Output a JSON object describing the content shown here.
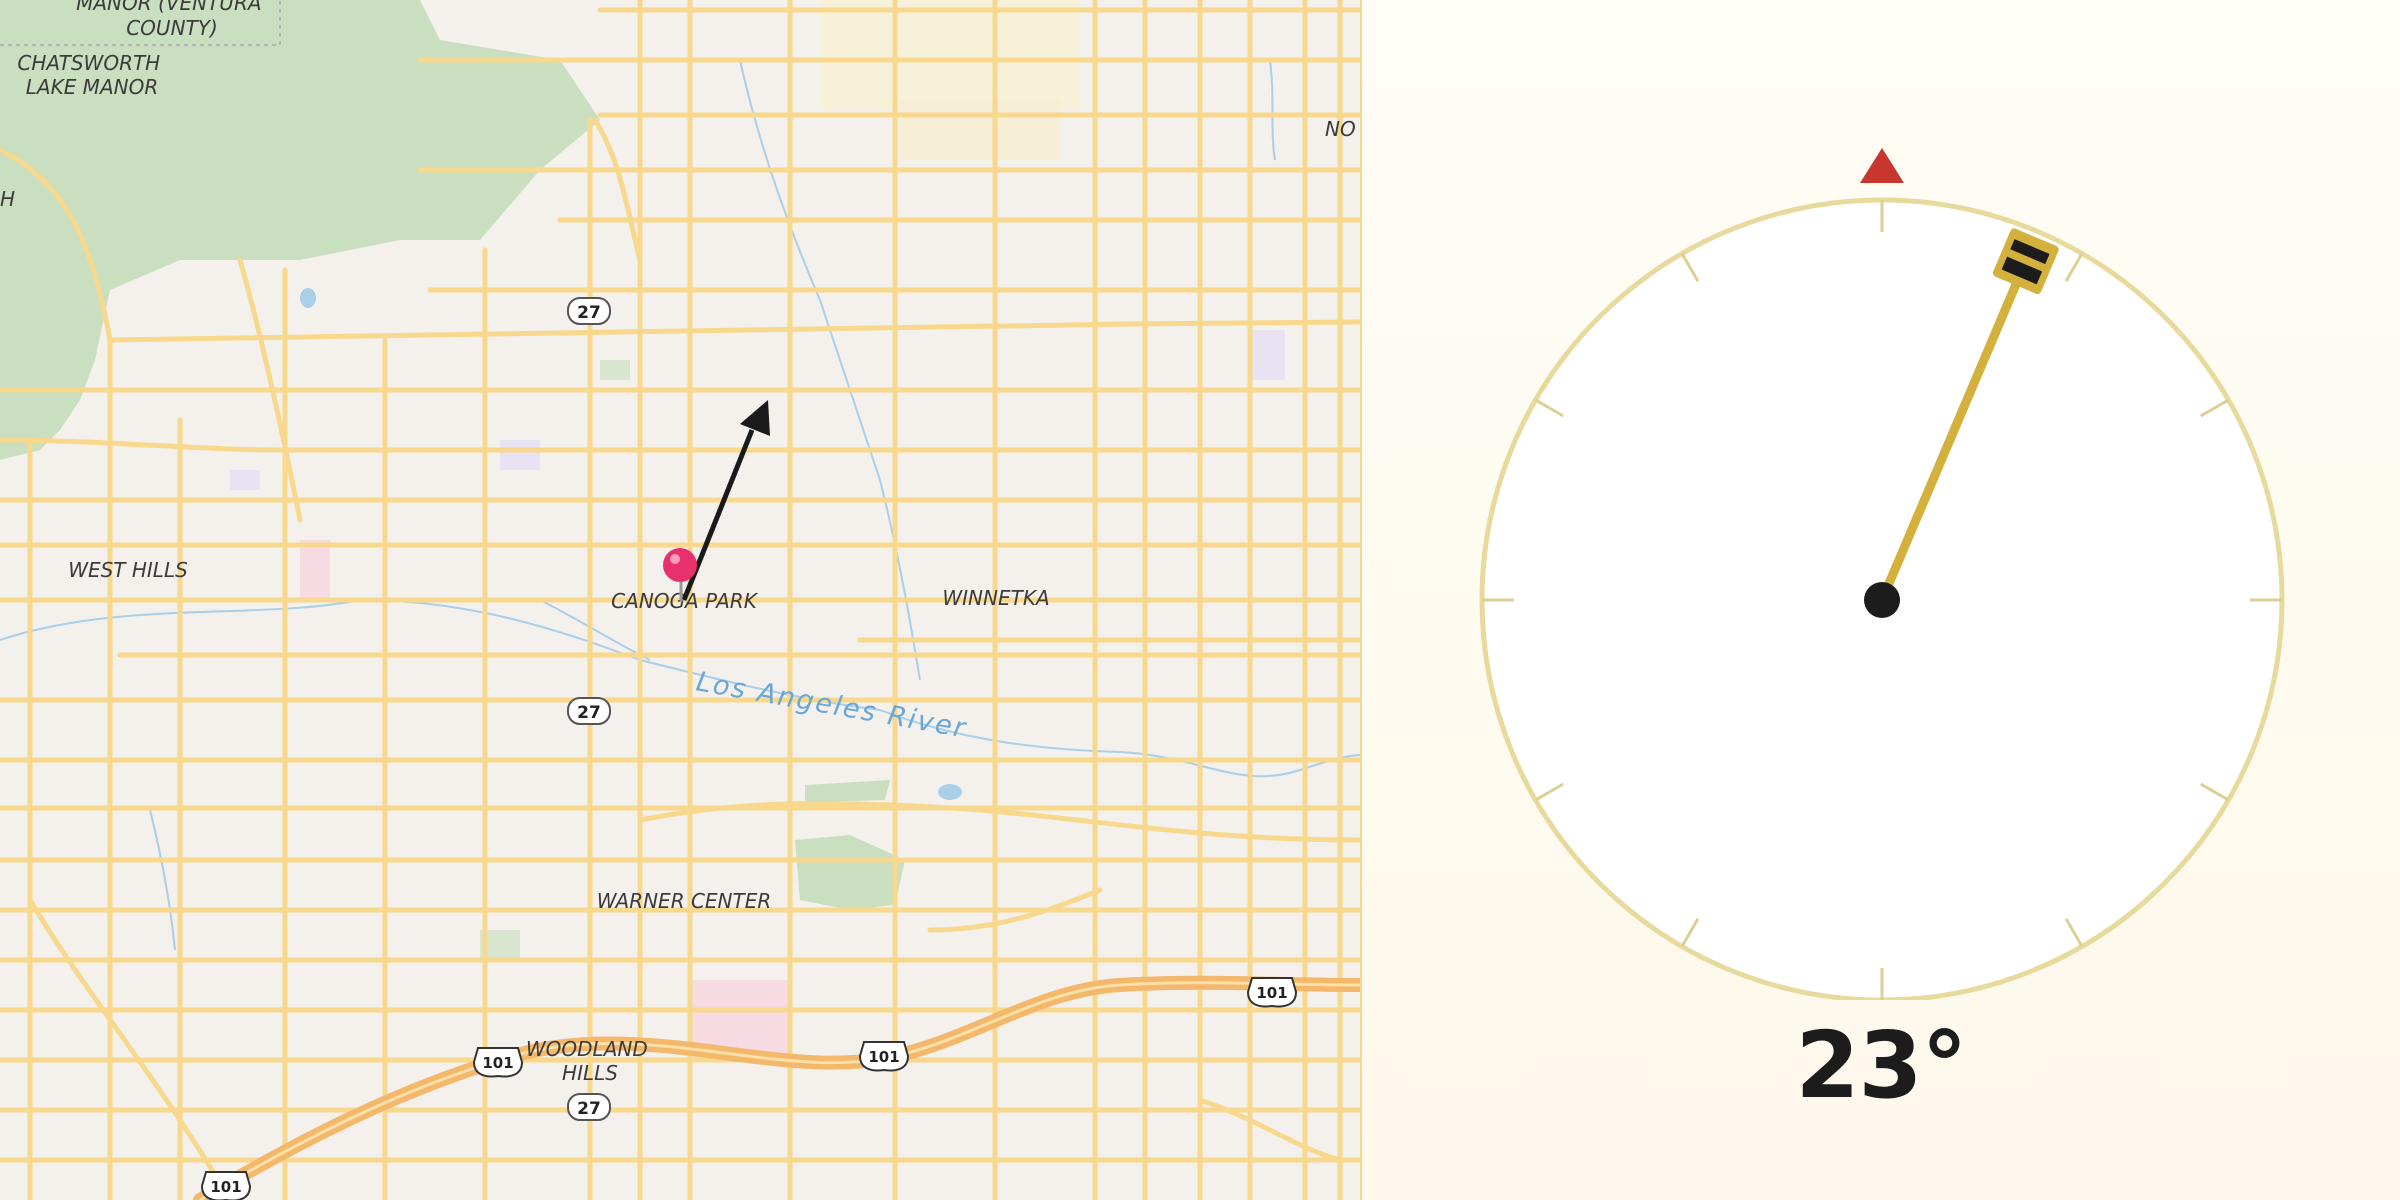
{
  "map": {
    "places": [
      {
        "id": "manor",
        "lines": [
          "MANOR (VENTURA",
          "COUNTY)"
        ]
      },
      {
        "id": "chatsworth-lake-manor",
        "lines": [
          "CHATSWORTH",
          "LAKE MANOR"
        ]
      },
      {
        "id": "west-hills",
        "lines": [
          "WEST HILLS"
        ]
      },
      {
        "id": "canoga-park",
        "lines": [
          "CANOGA PARK"
        ]
      },
      {
        "id": "winnetka",
        "lines": [
          "WINNETKA"
        ]
      },
      {
        "id": "warner-center",
        "lines": [
          "WARNER CENTER"
        ]
      },
      {
        "id": "woodland-hills",
        "lines": [
          "WOODLAND",
          "HILLS"
        ]
      },
      {
        "id": "edge-no",
        "lines": [
          "NO"
        ]
      },
      {
        "id": "edge-h",
        "lines": [
          "H"
        ]
      }
    ],
    "river_label": "Los Angeles River",
    "shields": [
      {
        "id": "sr27-north",
        "label": "27",
        "type": "state"
      },
      {
        "id": "sr27-mid",
        "label": "27",
        "type": "state"
      },
      {
        "id": "sr27-south",
        "label": "27",
        "type": "state"
      },
      {
        "id": "us101-west",
        "label": "101",
        "type": "us"
      },
      {
        "id": "us101-mid",
        "label": "101",
        "type": "us"
      },
      {
        "id": "us101-east",
        "label": "101",
        "type": "us"
      },
      {
        "id": "us101-sw",
        "label": "101",
        "type": "us"
      }
    ],
    "marker": {
      "icon": "map-pin-icon",
      "color": "#e8306e"
    },
    "heading_arrow": {
      "icon": "direction-arrow-icon",
      "color": "#1a1a1a"
    }
  },
  "compass": {
    "heading_deg": 23,
    "heading_text": "23°",
    "north_marker_color": "#c8372d",
    "needle_color": "#d4b03c",
    "ring_color": "#e8da9c"
  },
  "colors": {
    "road": "#f7d88d",
    "freeway": "#f3b86b",
    "park": "#c9dfc0",
    "water": "#a9cfe9"
  }
}
